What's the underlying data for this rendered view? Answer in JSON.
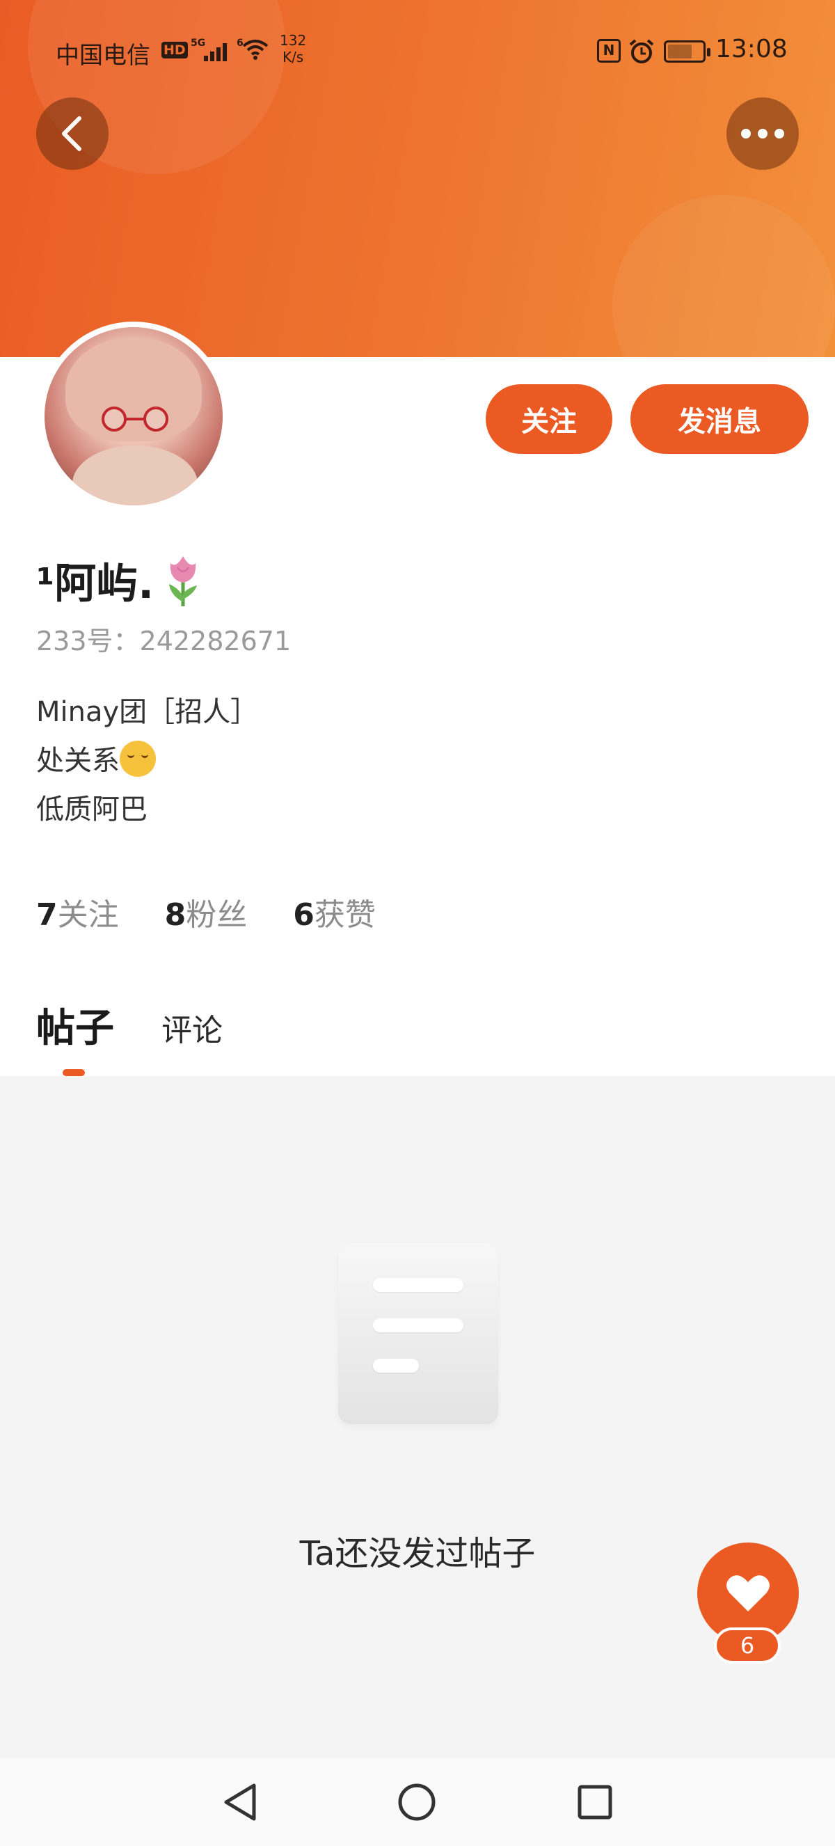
{
  "status_bar": {
    "carrier": "中国电信",
    "hd": "HD",
    "network": "5G",
    "network2": "6",
    "speed_value": "132",
    "speed_unit": "K/s",
    "nfc": "N",
    "time": "13:08",
    "battery_level": 0.7
  },
  "profile": {
    "name": "¹阿屿.",
    "uid": "233号：242282671",
    "bio_line1": "Minay团［招人］",
    "bio_line2": "处关系",
    "bio_line3": "低质阿巴"
  },
  "actions": {
    "follow": "关注",
    "message": "发消息"
  },
  "stats": [
    {
      "num": "7",
      "label": "关注"
    },
    {
      "num": "8",
      "label": "粉丝"
    },
    {
      "num": "6",
      "label": "获赞"
    }
  ],
  "tabs": {
    "posts": "帖子",
    "comments": "评论"
  },
  "empty_state": {
    "text": "Ta还没发过帖子"
  },
  "like": {
    "count": "6"
  },
  "colors": {
    "accent": "#ec5a24",
    "banner_start": "#ea5c25",
    "banner_end": "#f2903a"
  }
}
